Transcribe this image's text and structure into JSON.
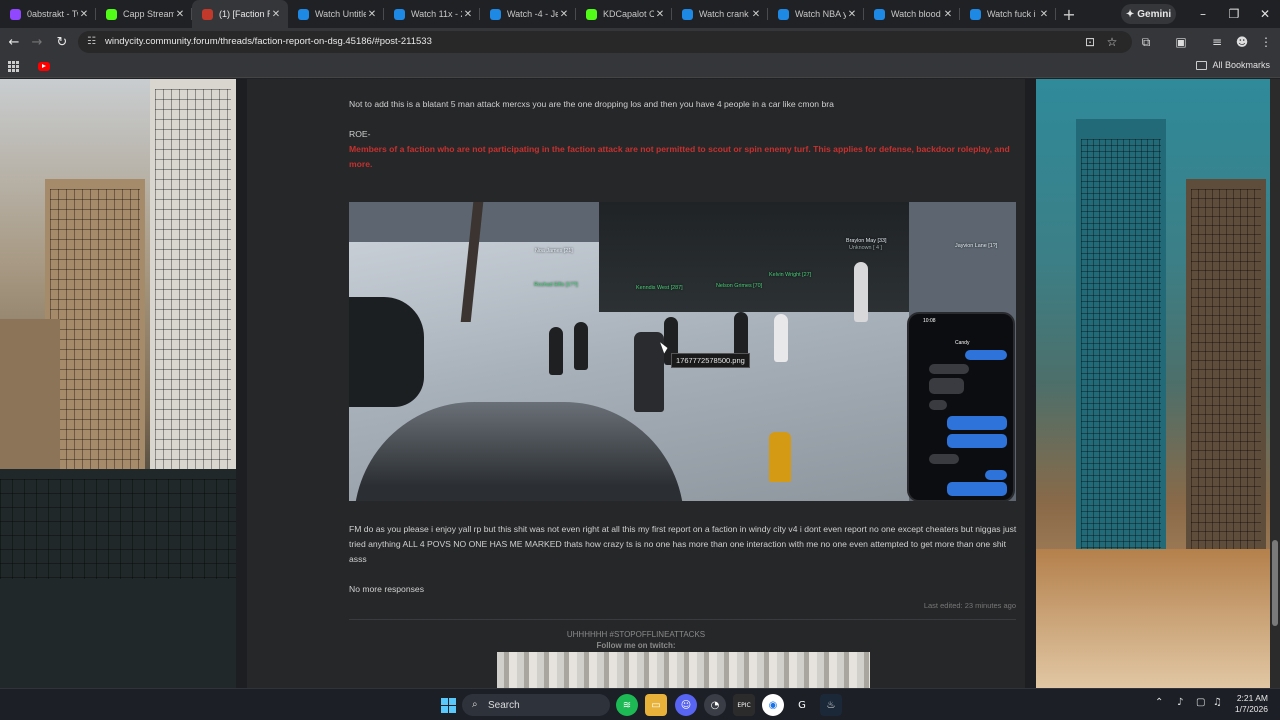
{
  "browser": {
    "tabs": [
      {
        "title": "0abstrakt - Tw",
        "icon": "twitch-icon",
        "color": "#9146ff",
        "active": false
      },
      {
        "title": "Capp Stream",
        "icon": "kick-icon",
        "color": "#53fc18",
        "active": false
      },
      {
        "title": "(1) [Faction Re",
        "icon": "forum-icon",
        "color": "#c0392b",
        "active": true
      },
      {
        "title": "Watch Untitle",
        "icon": "stream-icon",
        "color": "#1e88e5",
        "active": false
      },
      {
        "title": "Watch 11x - 2",
        "icon": "stream-icon",
        "color": "#1e88e5",
        "active": false
      },
      {
        "title": "Watch -4 - Je",
        "icon": "stream-icon",
        "color": "#1e88e5",
        "active": false
      },
      {
        "title": "KDCapalot C",
        "icon": "kick-icon",
        "color": "#53fc18",
        "active": false
      },
      {
        "title": "Watch crank",
        "icon": "stream-icon",
        "color": "#1e88e5",
        "active": false
      },
      {
        "title": "Watch NBA y",
        "icon": "stream-icon",
        "color": "#1e88e5",
        "active": false
      },
      {
        "title": "Watch blood",
        "icon": "stream-icon",
        "color": "#1e88e5",
        "active": false
      },
      {
        "title": "Watch fuck i",
        "icon": "stream-icon",
        "color": "#1e88e5",
        "active": false
      }
    ],
    "gemini_label": "Gemini",
    "url": "windycity.community.forum/threads/faction-report-on-dsg.45186/#post-211533",
    "bookmarks_label": "All Bookmarks"
  },
  "post": {
    "line1": "Not to add this is a blatant 5 man attack mercxs you are the one dropping los and then you have 4 people in a car like cmon bra",
    "roe_label": "ROE-",
    "rule_text": "Members of a faction who are not participating in the faction attack are not permitted to scout or spin enemy turf. This applies for defense, backdoor roleplay, and more.",
    "image_tooltip": "1767772578500.png",
    "body": "FM do as you please i enjoy yall rp but this shit was not even right at all this my first report on a faction in windy city v4 i dont even report no one except cheaters but niggas just tried anything ALL 4 POVS NO ONE HAS ME MARKED thats how crazy ts is no one has more than one interaction with me no one even attempted to get more than one shit asss",
    "closing": "No more responses",
    "last_edited": "Last edited: 23 minutes ago"
  },
  "game_screenshot": {
    "name_tags": [
      {
        "text": "Noa James [21]",
        "green": false
      },
      {
        "text": "Braylon May [33]",
        "green": false
      },
      {
        "text": "Unknown [ 4 ]",
        "green": false
      },
      {
        "text": "Jayvion Lane [1?]",
        "green": false
      },
      {
        "text": "Kelvin Wright [27]",
        "green": true
      },
      {
        "text": "Nelson Grimes [70]",
        "green": true
      },
      {
        "text": "Kenndis West [287]",
        "green": true
      },
      {
        "text": "Roshad Elfis [1??]",
        "green": true
      }
    ],
    "phone_time": "10:08",
    "phone_contact": "Candy"
  },
  "signature": {
    "line1": "UHHHHHH #STOPOFFLINEATTACKS",
    "line2": "Follow me on twitch:"
  },
  "taskbar": {
    "search_label": "Search",
    "time": "2:21 AM",
    "date": "1/7/2026"
  }
}
